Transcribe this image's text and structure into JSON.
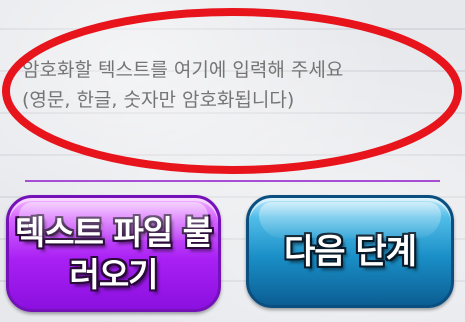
{
  "input": {
    "placeholder": "암호화할 텍스트를 여기에 입력해 주세요\n(영문, 한글, 숫자만 암호화됩니다)",
    "value": ""
  },
  "buttons": {
    "load_text_file": "텍스트 파일 불러오기",
    "next_step": "다음 단계"
  },
  "colors": {
    "annotation_ellipse": "#e8141c",
    "divider": "#a64fd6",
    "load_button": "#a920f4",
    "next_button": "#1a8fc7",
    "placeholder_text": "#7d7d83"
  }
}
